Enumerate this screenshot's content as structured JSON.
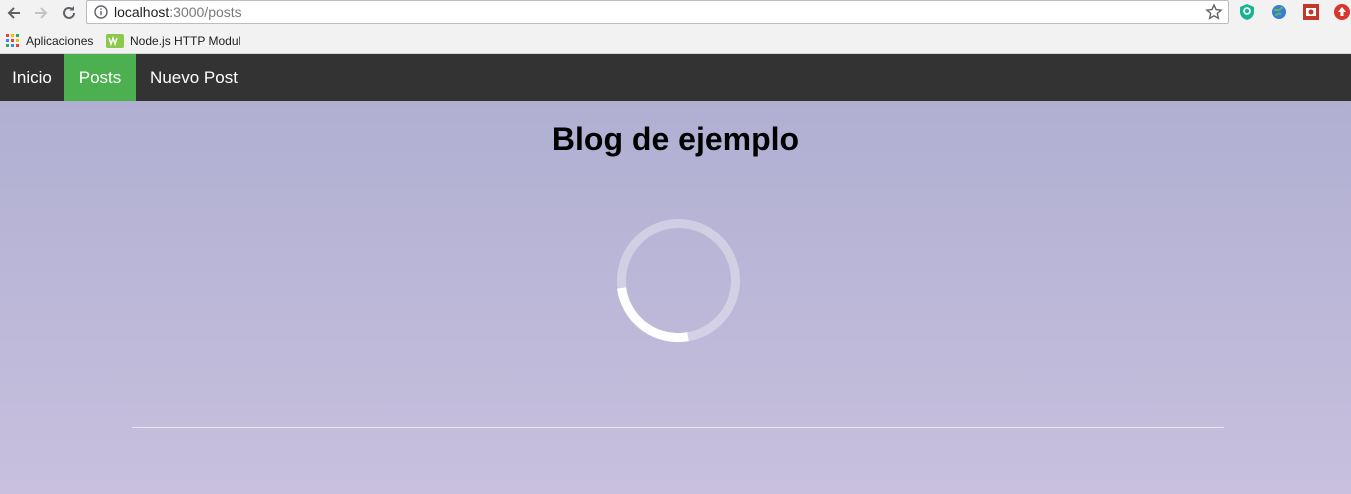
{
  "browser": {
    "url_host": "localhost",
    "url_path": ":3000/posts",
    "bookmarks": {
      "apps_label": "Aplicaciones",
      "node_label": "Node.js HTTP Module"
    }
  },
  "nav": {
    "items": [
      {
        "label": "Inicio"
      },
      {
        "label": "Posts",
        "active": true
      },
      {
        "label": "Nuevo Post"
      }
    ],
    "active_color": "#4caf50",
    "bar_color": "#333333"
  },
  "page": {
    "title": "Blog de ejemplo",
    "loading": true
  }
}
